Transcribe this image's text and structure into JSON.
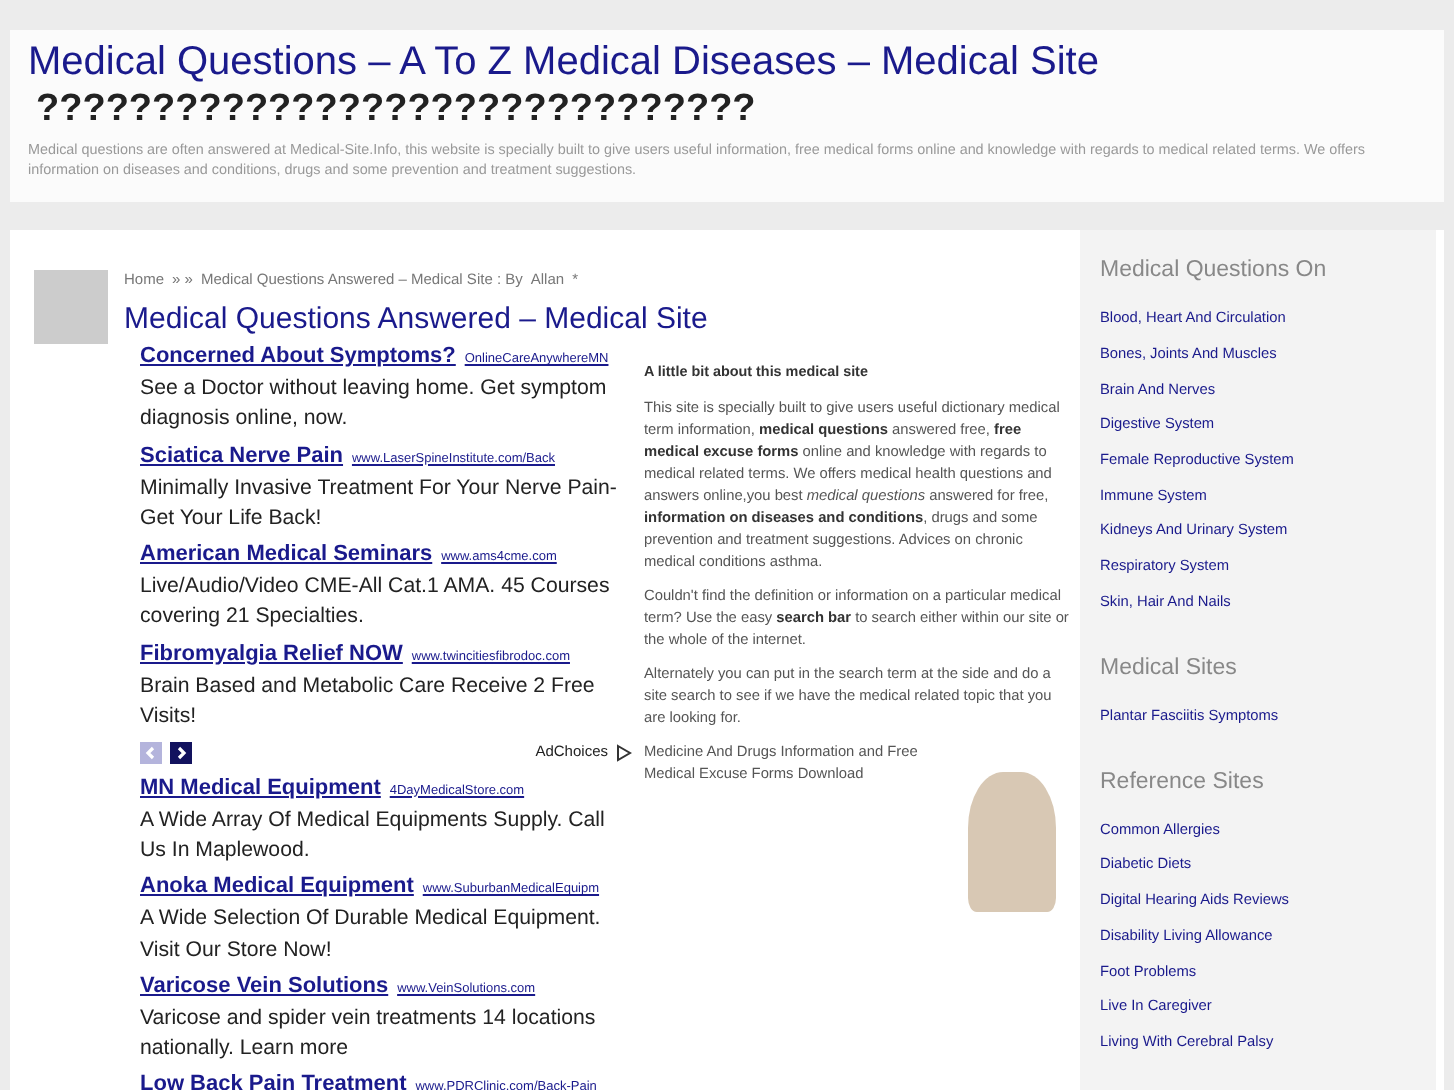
{
  "header": {
    "title": "Medical Questions – A To Z Medical Diseases – Medical Site",
    "subtitle": "???????????????????????????????",
    "description": "Medical questions are often answered at Medical-Site.Info, this website is specially built to give users useful information, free medical forms online and knowledge with regards to medical related terms. We offers information on diseases and conditions, drugs and some prevention and treatment suggestions."
  },
  "breadcrumb": {
    "home": "Home",
    "separator": "» »",
    "current": "Medical Questions Answered – Medical Site : By",
    "author": "Allan",
    "mark": "*"
  },
  "post_title": "Medical Questions Answered – Medical Site",
  "ads": [
    {
      "title": "Concerned About Symptoms?",
      "url": "OnlineCareAnywhereMN",
      "text": "See a Doctor without leaving home. Get symptom diagnosis online, now."
    },
    {
      "title": "Sciatica Nerve Pain",
      "url": "www.LaserSpineInstitute.com/Back",
      "text": "Minimally Invasive Treatment For Your Nerve Pain-Get Your Life Back!"
    },
    {
      "title": "American Medical Seminars",
      "url": "www.ams4cme.com",
      "text": "Live/Audio/Video CME-All Cat.1 AMA. 45 Courses covering 21 Specialties."
    },
    {
      "title": "Fibromyalgia Relief NOW",
      "url": "www.twincitiesfibrodoc.com",
      "text": "Brain Based and Metabolic Care Receive 2 Free Visits!"
    }
  ],
  "ad_nav": [
    {
      "kind": "prev",
      "disabled": true
    },
    {
      "kind": "next",
      "disabled": false
    }
  ],
  "adchoices": "AdChoices",
  "ads_2": [
    {
      "title": "MN Medical Equipment",
      "url": "4DayMedicalStore.com",
      "text": "A Wide Array Of Medical Equipments Supply. Call Us In Maplewood."
    },
    {
      "title": "Anoka Medical Equipment",
      "url": "www.SuburbanMedicalEquipm",
      "text": "A Wide Selection Of Durable Medical Equipment. Visit Our Store Now!"
    },
    {
      "title": "Varicose Vein Solutions",
      "url": "www.VeinSolutions.com",
      "text": "Varicose and spider vein treatments 14 locations nationally. Learn more"
    },
    {
      "title": "Low Back Pain Treatment",
      "url": "www.PDRClinic.com/Back-Pain"
    }
  ],
  "about": {
    "heading": "A little bit about this medical site",
    "paragraphs": [
      "This site is specially built to give users useful dictionary medical term information, **medical questions** answered free, **free medical excuse forms** online and knowledge with regards to medical related terms. We offers medical health questions and answers online,you best *medical questions* answered for free, **information on diseases and conditions**, drugs and some prevention and treatment suggestions. Advices on chronic medical conditions",
      "Couldn't find the definition or information on a particular medical term? Use the easy **search bar** to search either within our site or the whole of the internet.",
      "Alternately you can put in the search term at the side and do a site search to see if we have the medical related topic that you are looking for."
    ],
    "asthma_link": "asthma",
    "period": ".",
    "drugs_link": "Medicine And Drugs Information",
    "and_text": "and Free Medical Excuse Forms",
    "download_link": "Download"
  },
  "sidebar": [
    {
      "heading": "Medical Questions On",
      "links": [
        "Blood, Heart And Circulation",
        "Bones, Joints And Muscles",
        "Brain And Nerves",
        "Digestive System",
        "Female Reproductive System",
        "Immune System",
        "Kidneys And Urinary System",
        "Respiratory System",
        "Skin, Hair And Nails"
      ]
    },
    {
      "heading": "Medical Sites",
      "links": [
        "Plantar Fasciitis Symptoms"
      ]
    },
    {
      "heading": "Reference Sites",
      "links": [
        "Common Allergies",
        "Diabetic Diets",
        "Digital Hearing Aids Reviews",
        "Disability Living Allowance",
        "Foot Problems",
        "Live In Caregiver",
        "Living With Cerebral Palsy"
      ]
    }
  ]
}
